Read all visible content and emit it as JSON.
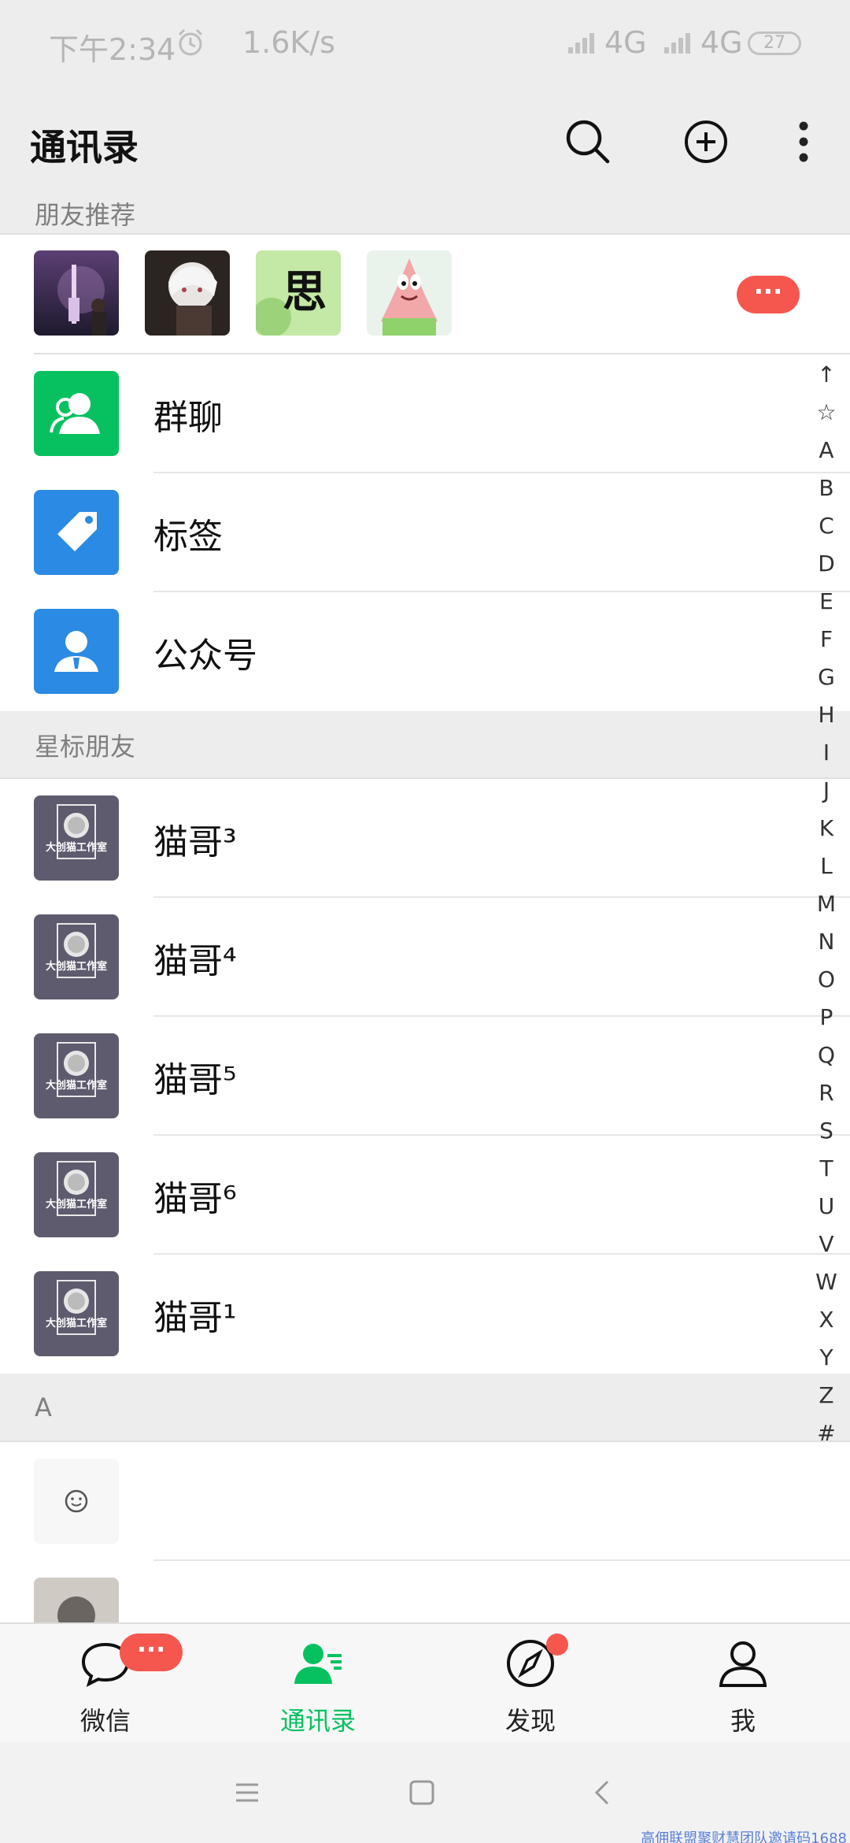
{
  "status_bar": {
    "time": "下午2:34",
    "speed": "1.6K/s",
    "network_1": "4G",
    "network_2": "4G",
    "battery": "27",
    "alarm_icon": "alarm-icon",
    "signal_icon": "signal-icon"
  },
  "header": {
    "title": "通讯录",
    "search_icon": "search-icon",
    "add_icon": "plus-circle-icon",
    "more_icon": "more-vertical-icon"
  },
  "friend_recommend": {
    "title": "朋友推荐",
    "avatars": [
      "avatar-tower",
      "avatar-anime",
      "avatar-calligraphy",
      "avatar-patrick"
    ],
    "calligraphy_char": "思",
    "more_badge": "···"
  },
  "function_items": [
    {
      "label": "群聊",
      "icon": "group-chat-icon",
      "color": "#07c160"
    },
    {
      "label": "标签",
      "icon": "tag-icon",
      "color": "#2b8ae3"
    },
    {
      "label": "公众号",
      "icon": "official-account-icon",
      "color": "#2b8ae3"
    }
  ],
  "starred_section": {
    "title": "星标朋友",
    "contacts": [
      {
        "name": "猫哥³"
      },
      {
        "name": "猫哥⁴"
      },
      {
        "name": "猫哥⁵"
      },
      {
        "name": "猫哥⁶"
      },
      {
        "name": "猫哥¹"
      }
    ],
    "avatar_text": "大创猫工作室"
  },
  "a_section": {
    "title": "A",
    "contacts": [
      {
        "name": "",
        "avatar": "smiley-icon"
      },
      {
        "name": "@@@",
        "avatar": "avatar-person"
      }
    ]
  },
  "index_bar": [
    "↑",
    "☆",
    "A",
    "B",
    "C",
    "D",
    "E",
    "F",
    "G",
    "H",
    "I",
    "J",
    "K",
    "L",
    "M",
    "N",
    "O",
    "P",
    "Q",
    "R",
    "S",
    "T",
    "U",
    "V",
    "W",
    "X",
    "Y",
    "Z",
    "#"
  ],
  "tabs": [
    {
      "label": "微信",
      "icon": "chat-bubble-icon",
      "active": false,
      "badge": "···"
    },
    {
      "label": "通讯录",
      "icon": "contacts-icon",
      "active": true
    },
    {
      "label": "发现",
      "icon": "compass-icon",
      "active": false,
      "dot": true
    },
    {
      "label": "我",
      "icon": "person-icon",
      "active": false
    }
  ],
  "nav_bar": {
    "menu_icon": "menu-icon",
    "home_icon": "home-icon",
    "back_icon": "back-icon"
  },
  "watermark": "高佣联盟聚财慧团队邀请码1688",
  "colors": {
    "accent": "#07c160",
    "badge": "#f5574f",
    "blue": "#2b8ae3"
  }
}
